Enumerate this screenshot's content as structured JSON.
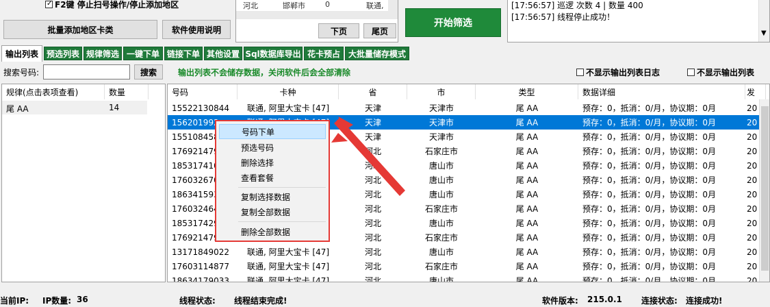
{
  "top": {
    "f2_label": "F2键 停止扫号操作/停止添加地区",
    "batch_add_button": "批量添加地区卡类",
    "help_button": "软件使用说明",
    "mini_table_row": [
      "河北",
      "邯郸市",
      "0",
      "联通,"
    ],
    "prev_page_button": "下页",
    "last_page_button": "尾页",
    "start_button": "开始筛选",
    "log_lines": [
      "[17:56:57] 巡逻 次数 4 | 数量 400",
      "[17:56:57] 线程停止成功！"
    ]
  },
  "tabs": [
    "输出列表",
    "预选列表",
    "规律筛选",
    "一键下单",
    "链接下单",
    "其他设置",
    "Sql数据库导出",
    "花卡预占",
    "大批量储存模式"
  ],
  "search": {
    "label": "搜索号码:",
    "value": "",
    "button": "搜索",
    "notice": "输出列表不会储存数据，关闭软件后会全部清除"
  },
  "options": {
    "hide_log": "不显示输出列表日志",
    "hide_list": "不显示输出列表"
  },
  "left_table": {
    "headers": [
      "规律(点击表项查看)",
      "数量"
    ],
    "rows": [
      [
        "尾 AA",
        "14"
      ]
    ]
  },
  "main_table": {
    "headers": [
      "号码",
      "卡种",
      "省",
      "市",
      "类型",
      "数据详细",
      "发"
    ],
    "rows": [
      [
        "15522130844",
        "联通, 阿里大宝卡 [47]",
        "天津",
        "天津市",
        "尾 AA",
        "预存：0，抵消：0/月，协议期：0月",
        "20"
      ],
      [
        "156201992",
        "联通, 阿里大宝卡 [47]",
        "天津",
        "天津市",
        "尾 AA",
        "预存：0，抵消：0/月，协议期：0月",
        "20"
      ],
      [
        "155108458",
        "",
        "天津",
        "天津市",
        "尾 AA",
        "预存：0，抵消：0/月，协议期：0月",
        "20"
      ],
      [
        "176921479",
        "",
        "河北",
        "石家庄市",
        "尾 AA",
        "预存：0，抵消：0/月，协议期：0月",
        "20"
      ],
      [
        "185317410",
        "",
        "河北",
        "唐山市",
        "尾 AA",
        "预存：0，抵消：0/月，协议期：0月",
        "20"
      ],
      [
        "176032670",
        "",
        "河北",
        "唐山市",
        "尾 AA",
        "预存：0，抵消：0/月，协议期：0月",
        "20"
      ],
      [
        "186341593",
        "",
        "河北",
        "唐山市",
        "尾 AA",
        "预存：0，抵消：0/月，协议期：0月",
        "20"
      ],
      [
        "176032464",
        "",
        "河北",
        "石家庄市",
        "尾 AA",
        "预存：0，抵消：0/月，协议期：0月",
        "20"
      ],
      [
        "185317429",
        "",
        "河北",
        "唐山市",
        "尾 AA",
        "预存：0，抵消：0/月，协议期：0月",
        "20"
      ],
      [
        "176921479",
        "",
        "河北",
        "石家庄市",
        "尾 AA",
        "预存：0，抵消：0/月，协议期：0月",
        "20"
      ],
      [
        "13171849022",
        "联通, 阿里大宝卡 [47]",
        "河北",
        "唐山市",
        "尾 AA",
        "预存：0，抵消：0/月，协议期：0月",
        "20"
      ],
      [
        "17603114877",
        "联通, 阿里大宝卡 [47]",
        "河北",
        "石家庄市",
        "尾 AA",
        "预存：0，抵消：0/月，协议期：0月",
        "20"
      ],
      [
        "18634179033",
        "联通, 阿里大宝卡 [47]",
        "河北",
        "唐山市",
        "尾 AA",
        "预存：0，抵消：0/月，协议期：0月",
        "20"
      ]
    ]
  },
  "context_menu": [
    "号码下单",
    "预选号码",
    "删除选择",
    "查看套餐",
    "复制选择数据",
    "复制全部数据",
    "删除全部数据"
  ],
  "status": {
    "ip_label": "当前IP:",
    "ip_count_label": "IP数量:",
    "ip_count": "36",
    "thread_label": "线程状态:",
    "thread_value": "线程结束完成!",
    "version_label": "软件版本:",
    "version_value": "215.0.1",
    "conn_label": "连接状态:",
    "conn_value": "连接成功!"
  },
  "colors": {
    "tab_green": "#1f7a3a",
    "start_green": "#1f8a3a",
    "selection_blue": "#0078d7",
    "highlight_red": "#e53935",
    "notice_green": "#1a8a2a"
  }
}
